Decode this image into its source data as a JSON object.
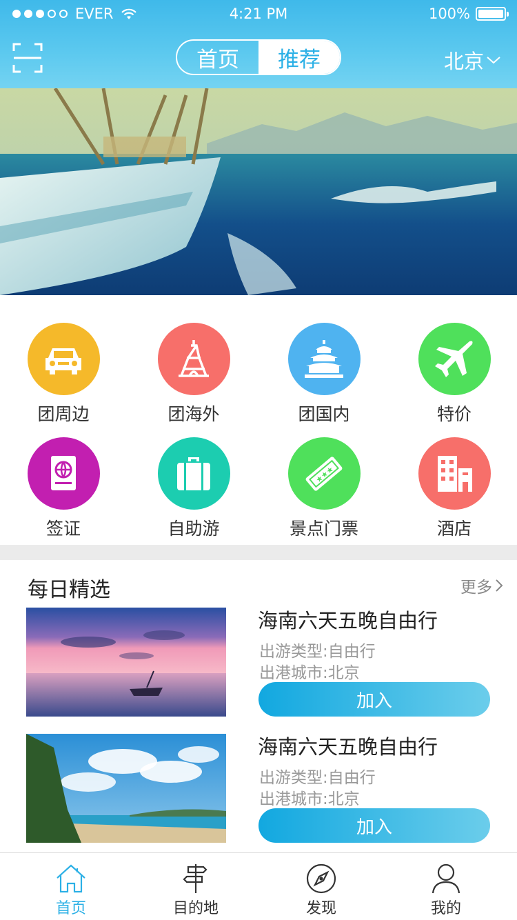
{
  "status_bar": {
    "carrier": "EVER",
    "time": "4:21 PM",
    "battery": "100%"
  },
  "header": {
    "tabs": [
      "首页",
      "推荐"
    ],
    "selected_tab": "推荐",
    "city": "北京"
  },
  "categories": [
    {
      "label": "团周边",
      "icon": "car-icon",
      "color": "#f5b92a"
    },
    {
      "label": "团海外",
      "icon": "tower-icon",
      "color": "#f76f6a"
    },
    {
      "label": "团国内",
      "icon": "temple-icon",
      "color": "#4fb3f0"
    },
    {
      "label": "特价",
      "icon": "plane-icon",
      "color": "#4fe05b"
    },
    {
      "label": "签证",
      "icon": "passport-icon",
      "color": "#c21fb0"
    },
    {
      "label": "自助游",
      "icon": "suitcase-icon",
      "color": "#1ccdb0"
    },
    {
      "label": "景点门票",
      "icon": "ticket-icon",
      "color": "#4fe05b"
    },
    {
      "label": "酒店",
      "icon": "hotel-icon",
      "color": "#f76f6a"
    }
  ],
  "daily": {
    "title": "每日精选",
    "more": "更多",
    "items": [
      {
        "name": "海南六天五晚自由行",
        "type": "出游类型:自由行",
        "city": "出港城市:北京",
        "button": "加入"
      },
      {
        "name": "海南六天五晚自由行",
        "type": "出游类型:自由行",
        "city": "出港城市:北京",
        "button": "加入"
      }
    ]
  },
  "tabbar": [
    {
      "label": "首页",
      "icon": "home-icon"
    },
    {
      "label": "目的地",
      "icon": "signpost-icon"
    },
    {
      "label": "发现",
      "icon": "compass-icon"
    },
    {
      "label": "我的",
      "icon": "user-icon"
    }
  ],
  "accent_color": "#2bb0e6"
}
